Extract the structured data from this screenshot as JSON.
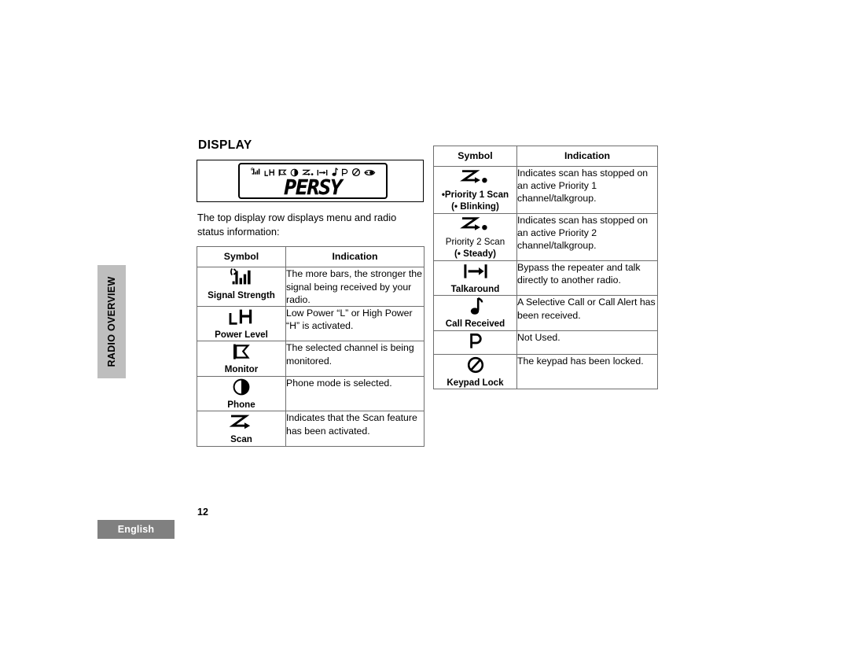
{
  "sidebar": {
    "tab_label": "RADIO OVERVIEW"
  },
  "footer": {
    "page_number": "12",
    "language_badge": "English"
  },
  "main": {
    "section_title": "DISPLAY",
    "intro_text": "The top display row displays menu and radio status information:",
    "lcd": {
      "segment_text": "PERSY",
      "icons": [
        "signal-strength-icon",
        "power-level-lh-icon",
        "monitor-flag-icon",
        "phone-icon",
        "priority-scan-icon",
        "talkaround-icon",
        "call-received-note-icon",
        "p-icon",
        "keypad-lock-icon",
        "eye-icon"
      ]
    },
    "left_table": {
      "headers": [
        "Symbol",
        "Indication"
      ],
      "rows": [
        {
          "icon": "signal-strength-icon",
          "label": "Signal Strength",
          "label_bold": true,
          "sub": "",
          "indication": "The more bars, the stronger the signal being received by your radio."
        },
        {
          "icon": "power-level-lh-icon",
          "label": "Power Level",
          "label_bold": true,
          "sub": "",
          "indication": "Low Power “L” or High Power “H” is activated."
        },
        {
          "icon": "monitor-flag-icon",
          "label": "Monitor",
          "label_bold": true,
          "sub": "",
          "indication": "The selected channel is being monitored."
        },
        {
          "icon": "phone-icon",
          "label": "Phone",
          "label_bold": true,
          "sub": "",
          "indication": "Phone mode is selected."
        },
        {
          "icon": "scan-icon",
          "label": "Scan",
          "label_bold": true,
          "sub": "",
          "indication": "Indicates that the Scan feature has been activated."
        }
      ]
    },
    "right_table": {
      "headers": [
        "Symbol",
        "Indication"
      ],
      "rows": [
        {
          "icon": "priority-scan-icon",
          "label": "•Priority 1 Scan",
          "label_bold": true,
          "sub": "(• Blinking)",
          "indication": "Indicates scan has stopped on an active Priority 1 channel/talkgroup."
        },
        {
          "icon": "priority-scan-icon",
          "label": "Priority 2 Scan",
          "label_bold": false,
          "sub": "(•  Steady)",
          "indication": "Indicates scan has stopped on an active Priority 2 channel/talkgroup."
        },
        {
          "icon": "talkaround-icon",
          "label": "Talkaround",
          "label_bold": true,
          "sub": "",
          "indication": "Bypass the repeater and talk directly to another radio."
        },
        {
          "icon": "call-received-note-icon",
          "label": "Call Received",
          "label_bold": true,
          "sub": "",
          "indication": "A Selective Call or Call Alert has been received."
        },
        {
          "icon": "p-icon",
          "label": "",
          "label_bold": true,
          "sub": "",
          "indication": "Not Used."
        },
        {
          "icon": "keypad-lock-icon",
          "label": "Keypad Lock",
          "label_bold": true,
          "sub": "",
          "indication": "The keypad has been locked."
        }
      ]
    }
  },
  "colors": {
    "sidebar_tab_bg": "#bebebe",
    "language_badge_bg": "#808080",
    "table_border": "#6e6e6e",
    "text": "#000000"
  }
}
